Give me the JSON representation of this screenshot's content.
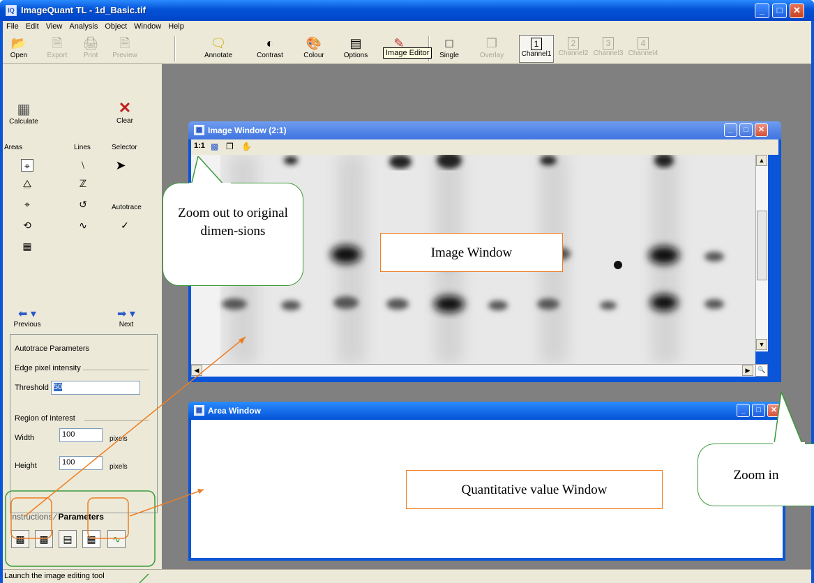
{
  "window": {
    "title": "ImageQuant TL - 1d_Basic.tif",
    "app_icon": "IQ",
    "minimize": "_",
    "maximize": "□",
    "close": "✕"
  },
  "menu": [
    "File",
    "Edit",
    "View",
    "Analysis",
    "Object",
    "Window",
    "Help"
  ],
  "toolbar": {
    "open": "Open",
    "export": "Export",
    "print": "Print",
    "preview": "Preview",
    "annotate": "Annotate",
    "contrast": "Contrast",
    "colour": "Colour",
    "options": "Options",
    "image_editor_tooltip": "Image Editor",
    "single": "Single",
    "overlay": "Overlay",
    "channel1": "Channel1",
    "channel2": "Channel2",
    "channel3": "Channel3",
    "channel4": "Channel4",
    "ch1": "1",
    "ch2": "2",
    "ch3": "3",
    "ch4": "4"
  },
  "left_panel": {
    "calculate": "Calculate",
    "clear": "Clear",
    "areas": "Areas",
    "lines": "Lines",
    "selector": "Selector",
    "autotrace": "Autotrace",
    "previous": "Previous",
    "next": "Next"
  },
  "params": {
    "heading": "Autotrace Parameters",
    "edge_group": "Edge pixel intensity",
    "threshold_label": "Threshold",
    "threshold_value": "50",
    "roi_group": "Region of Interest",
    "width_label": "Width",
    "width_value": "100",
    "width_unit": "pixels",
    "height_label": "Height",
    "height_value": "100",
    "height_unit": "pixels"
  },
  "tabs": {
    "instructions": "Instructions",
    "parameters": "Parameters"
  },
  "image_window": {
    "title": "Image Window (2:1)",
    "zoom_1_1": "1:1"
  },
  "area_window": {
    "title": "Area Window"
  },
  "status": "Launch the image editing tool",
  "annotations": {
    "zoom_out": "Zoom out to original dimen-sions",
    "image_window": "Image Window",
    "quant_window": "Quantitative value Window",
    "zoom_in": "Zoom in"
  },
  "colors": {
    "xp_blue": "#0a55d8",
    "callout_green": "#3a9a3a",
    "arrow_orange": "#ef7d22"
  }
}
